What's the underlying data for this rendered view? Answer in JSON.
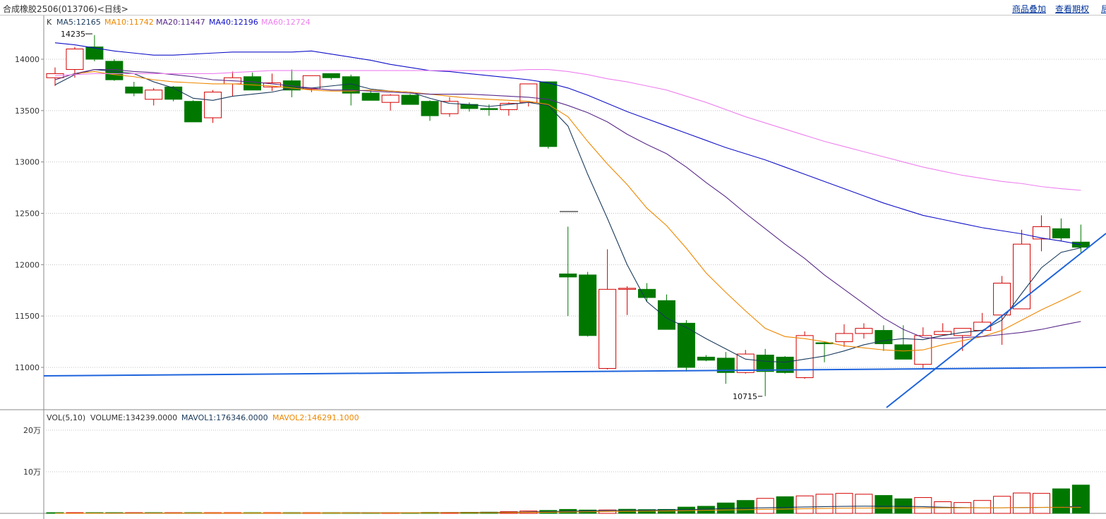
{
  "header": {
    "title": "合成橡胶2506(013706)<日线>",
    "links": [
      "商品叠加",
      "查看期权"
    ],
    "edge_glyph": "局"
  },
  "colors": {
    "up": "#d40000",
    "down": "#007800",
    "ma5": "#1a3a5c",
    "ma10": "#ee8800",
    "ma20": "#5a2a8a",
    "ma40": "#1010c8",
    "ma60": "#ee80ee",
    "trendline": "#1e64dc",
    "grid": "#c0c0c0"
  },
  "chart_data": [
    {
      "type": "candlestick",
      "indicator_prefix": "K",
      "ma_labels": [
        "MA5:12165",
        "MA10:11742",
        "MA20:11447",
        "MA40:12196",
        "MA60:12724"
      ],
      "y_ticks": [
        14000,
        13500,
        13000,
        12500,
        12000,
        11500,
        11000
      ],
      "ylim": [
        10660,
        14400
      ],
      "annotations": {
        "high": {
          "label": "14235",
          "value": 14235,
          "index": 2
        },
        "low": {
          "label": "10715",
          "value": 10715,
          "index": 36
        }
      },
      "ohlc": [
        [
          13820,
          13920,
          13740,
          13860
        ],
        [
          13900,
          14120,
          13820,
          14100
        ],
        [
          14120,
          14235,
          13980,
          14000
        ],
        [
          13980,
          14000,
          13790,
          13800
        ],
        [
          13730,
          13780,
          13640,
          13670
        ],
        [
          13610,
          13720,
          13550,
          13700
        ],
        [
          13730,
          13740,
          13590,
          13610
        ],
        [
          13590,
          13600,
          13390,
          13390
        ],
        [
          13430,
          13700,
          13380,
          13680
        ],
        [
          13760,
          13880,
          13640,
          13820
        ],
        [
          13830,
          13870,
          13700,
          13700
        ],
        [
          13730,
          13860,
          13690,
          13770
        ],
        [
          13790,
          13900,
          13630,
          13700
        ],
        [
          13710,
          13840,
          13680,
          13840
        ],
        [
          13860,
          13860,
          13800,
          13820
        ],
        [
          13830,
          13850,
          13550,
          13670
        ],
        [
          13670,
          13700,
          13600,
          13600
        ],
        [
          13580,
          13660,
          13500,
          13650
        ],
        [
          13650,
          13660,
          13560,
          13560
        ],
        [
          13590,
          13600,
          13400,
          13450
        ],
        [
          13470,
          13630,
          13440,
          13590
        ],
        [
          13560,
          13580,
          13490,
          13520
        ],
        [
          13520,
          13560,
          13450,
          13510
        ],
        [
          13510,
          13580,
          13450,
          13570
        ],
        [
          13580,
          13720,
          13540,
          13760
        ],
        [
          13780,
          13780,
          13130,
          13150
        ],
        [
          11910,
          12370,
          11500,
          11880
        ],
        [
          11900,
          11930,
          11300,
          11310
        ],
        [
          10990,
          12150,
          10980,
          11760
        ],
        [
          11760,
          11790,
          11510,
          11770
        ],
        [
          11760,
          11820,
          11640,
          11680
        ],
        [
          11650,
          11710,
          11370,
          11370
        ],
        [
          11430,
          11460,
          10960,
          11000
        ],
        [
          11100,
          11120,
          11060,
          11070
        ],
        [
          11090,
          11150,
          10840,
          10950
        ],
        [
          10950,
          11170,
          10940,
          11130
        ],
        [
          11120,
          11180,
          10720,
          10960
        ],
        [
          11100,
          11110,
          10940,
          10950
        ],
        [
          10900,
          11350,
          10890,
          11310
        ],
        [
          11240,
          11250,
          11050,
          11230
        ],
        [
          11250,
          11420,
          11200,
          11330
        ],
        [
          11330,
          11430,
          11280,
          11380
        ],
        [
          11360,
          11410,
          11160,
          11230
        ],
        [
          11220,
          11410,
          11090,
          11080
        ],
        [
          11030,
          11390,
          10990,
          11310
        ],
        [
          11320,
          11430,
          11310,
          11350
        ],
        [
          11310,
          11380,
          11160,
          11380
        ],
        [
          11360,
          11530,
          11330,
          11440
        ],
        [
          11510,
          11890,
          11220,
          11820
        ],
        [
          11570,
          12340,
          11720,
          12200
        ],
        [
          12250,
          12480,
          12130,
          12370
        ],
        [
          12350,
          12450,
          12230,
          12260
        ],
        [
          12220,
          12390,
          12120,
          12170
        ]
      ],
      "lines": [
        {
          "name": "MA5",
          "color": "#1a3a5c",
          "values": [
            13750,
            13850,
            13900,
            13880,
            13860,
            13780,
            13720,
            13620,
            13600,
            13640,
            13660,
            13680,
            13720,
            13720,
            13740,
            13760,
            13710,
            13690,
            13680,
            13620,
            13570,
            13560,
            13540,
            13560,
            13580,
            13550,
            13350,
            12880,
            12450,
            12000,
            11640,
            11480,
            11390,
            11280,
            11180,
            11080,
            11060,
            11050,
            11080,
            11110,
            11160,
            11220,
            11260,
            11280,
            11270,
            11310,
            11340,
            11360,
            11460,
            11720,
            11970,
            12120,
            12165
          ]
        },
        {
          "name": "MA10",
          "color": "#ee8800",
          "values": [
            13800,
            13860,
            13880,
            13850,
            13830,
            13800,
            13780,
            13770,
            13760,
            13760,
            13750,
            13740,
            13720,
            13700,
            13690,
            13690,
            13700,
            13690,
            13680,
            13660,
            13640,
            13620,
            13610,
            13600,
            13590,
            13560,
            13440,
            13200,
            12980,
            12780,
            12550,
            12380,
            12160,
            11920,
            11730,
            11550,
            11380,
            11300,
            11280,
            11250,
            11210,
            11190,
            11170,
            11160,
            11170,
            11220,
            11260,
            11300,
            11360,
            11460,
            11560,
            11650,
            11742
          ]
        },
        {
          "name": "MA20",
          "color": "#5a2a8a",
          "values": [
            13800,
            13860,
            13900,
            13900,
            13880,
            13870,
            13850,
            13830,
            13800,
            13790,
            13780,
            13760,
            13740,
            13720,
            13700,
            13700,
            13690,
            13680,
            13670,
            13660,
            13660,
            13660,
            13650,
            13640,
            13630,
            13610,
            13550,
            13480,
            13390,
            13270,
            13170,
            13080,
            12950,
            12800,
            12660,
            12500,
            12350,
            12200,
            12060,
            11900,
            11760,
            11620,
            11480,
            11370,
            11290,
            11280,
            11290,
            11300,
            11320,
            11340,
            11370,
            11410,
            11447
          ]
        },
        {
          "name": "MA40",
          "color": "#1010c8",
          "values": [
            14160,
            14140,
            14110,
            14080,
            14060,
            14040,
            14040,
            14050,
            14060,
            14070,
            14070,
            14070,
            14070,
            14080,
            14050,
            14020,
            13990,
            13950,
            13920,
            13890,
            13880,
            13860,
            13840,
            13820,
            13800,
            13770,
            13720,
            13650,
            13570,
            13490,
            13420,
            13350,
            13280,
            13210,
            13140,
            13080,
            13020,
            12950,
            12880,
            12810,
            12740,
            12670,
            12600,
            12540,
            12480,
            12440,
            12400,
            12360,
            12330,
            12300,
            12260,
            12230,
            12196
          ]
        },
        {
          "name": "MA60",
          "color": "#ee80ee",
          "values": [
            13840,
            13850,
            13860,
            13860,
            13860,
            13860,
            13860,
            13860,
            13860,
            13870,
            13880,
            13890,
            13890,
            13890,
            13890,
            13890,
            13890,
            13890,
            13890,
            13890,
            13890,
            13890,
            13890,
            13890,
            13900,
            13900,
            13880,
            13850,
            13810,
            13780,
            13740,
            13700,
            13640,
            13580,
            13510,
            13440,
            13380,
            13320,
            13260,
            13200,
            13150,
            13100,
            13050,
            13000,
            12950,
            12910,
            12870,
            12840,
            12810,
            12790,
            12760,
            12740,
            12724
          ]
        }
      ]
    },
    {
      "type": "bar",
      "indicator_label": "VOL(5,10)",
      "legend": [
        "VOLUME:134239.0000",
        "MAVOL1:176346.0000",
        "MAVOL2:146291.1000"
      ],
      "y_ticks": [
        200000,
        100000
      ],
      "y_tick_labels": [
        "20万",
        "10万"
      ],
      "ylim": [
        0,
        225000
      ],
      "values": [
        0,
        500,
        500,
        800,
        800,
        600,
        700,
        900,
        700,
        800,
        700,
        900,
        1000,
        1100,
        1100,
        1600,
        1700,
        1500,
        1400,
        2200,
        2000,
        2500,
        2900,
        4000,
        5600,
        7000,
        9500,
        8000,
        8100,
        9800,
        9000,
        9500,
        15000,
        17000,
        25000,
        31000,
        36000,
        40000,
        42000,
        46000,
        48000,
        46000,
        43000,
        35000,
        38000,
        28000,
        26000,
        31000,
        41000,
        49000,
        48000,
        59000,
        68000
      ],
      "mavol1": [
        0,
        0,
        100,
        300,
        500,
        600,
        700,
        750,
        800,
        850,
        800,
        850,
        900,
        1000,
        1050,
        1200,
        1300,
        1400,
        1500,
        1700,
        1800,
        2000,
        2200,
        2700,
        3400,
        4200,
        5200,
        6000,
        6700,
        7400,
        7600,
        8400,
        8800,
        10000,
        11700,
        12700,
        13400,
        14300,
        15300,
        16200,
        16900,
        17200,
        17000,
        16900,
        16200,
        14800,
        13800,
        13500,
        13400,
        13800,
        14300,
        14800,
        17600
      ],
      "mavol2": [
        0,
        0,
        100,
        200,
        300,
        400,
        500,
        600,
        700,
        750,
        800,
        800,
        850,
        900,
        950,
        1000,
        1100,
        1200,
        1300,
        1400,
        1500,
        1600,
        1700,
        2000,
        2300,
        2700,
        3200,
        3800,
        4400,
        5000,
        5300,
        5900,
        6500,
        7300,
        8100,
        8800,
        9600,
        10300,
        11100,
        11800,
        12300,
        12700,
        12900,
        13000,
        13100,
        13200,
        13300,
        13400,
        13500,
        14000,
        14400,
        14600,
        14629
      ],
      "up": [
        false,
        true,
        false,
        false,
        true,
        false,
        true,
        false,
        true,
        true,
        false,
        true,
        false,
        true,
        false,
        false,
        false,
        true,
        false,
        false,
        true,
        false,
        false,
        true,
        true,
        false,
        false,
        false,
        true,
        false,
        false,
        false,
        false,
        false,
        false,
        false,
        true,
        false,
        true,
        true,
        true,
        true,
        false,
        false,
        true,
        true,
        true,
        true,
        true,
        true,
        true,
        false,
        false
      ]
    }
  ]
}
